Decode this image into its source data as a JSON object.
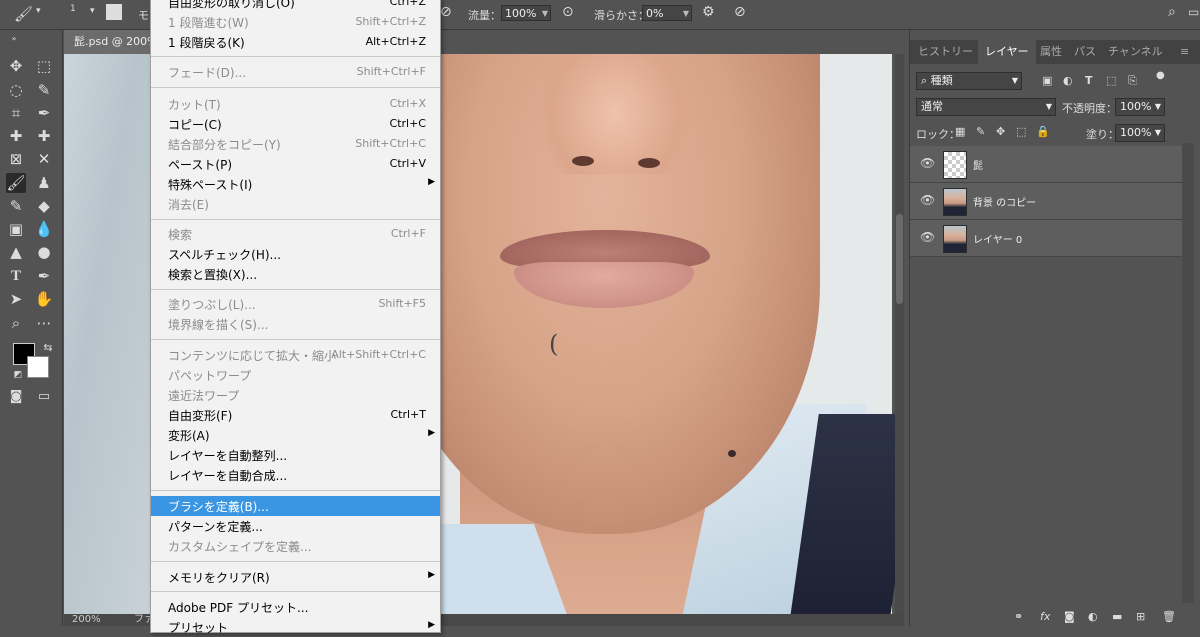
{
  "options_bar": {
    "brush_size": "1",
    "mode_label": "モ",
    "flow_label": "流量：",
    "flow_value": "100%",
    "smoothing_label": "滑らかさ：",
    "smoothing_value": "0%"
  },
  "document": {
    "tab_title": "髭.psd @ 200%",
    "zoom": "200%",
    "status": "ファ"
  },
  "edit_menu": {
    "items": [
      {
        "label": "自由変形の取り消し(O)",
        "shortcut": "Ctrl+Z",
        "disabled": false,
        "submenu": false
      },
      {
        "label": "1 段階進む(W)",
        "shortcut": "Shift+Ctrl+Z",
        "disabled": true,
        "submenu": false
      },
      {
        "label": "1 段階戻る(K)",
        "shortcut": "Alt+Ctrl+Z",
        "disabled": false,
        "submenu": false
      },
      {
        "label": "フェード(D)...",
        "shortcut": "Shift+Ctrl+F",
        "disabled": true,
        "submenu": false
      },
      {
        "label": "カット(T)",
        "shortcut": "Ctrl+X",
        "disabled": true,
        "submenu": false
      },
      {
        "label": "コピー(C)",
        "shortcut": "Ctrl+C",
        "disabled": false,
        "submenu": false
      },
      {
        "label": "結合部分をコピー(Y)",
        "shortcut": "Shift+Ctrl+C",
        "disabled": true,
        "submenu": false
      },
      {
        "label": "ペースト(P)",
        "shortcut": "Ctrl+V",
        "disabled": false,
        "submenu": false
      },
      {
        "label": "特殊ペースト(I)",
        "shortcut": "",
        "disabled": false,
        "submenu": true
      },
      {
        "label": "消去(E)",
        "shortcut": "",
        "disabled": true,
        "submenu": false
      },
      {
        "label": "検索",
        "shortcut": "Ctrl+F",
        "disabled": true,
        "submenu": false
      },
      {
        "label": "スペルチェック(H)...",
        "shortcut": "",
        "disabled": false,
        "submenu": false
      },
      {
        "label": "検索と置換(X)...",
        "shortcut": "",
        "disabled": false,
        "submenu": false
      },
      {
        "label": "塗りつぶし(L)...",
        "shortcut": "Shift+F5",
        "disabled": true,
        "submenu": false
      },
      {
        "label": "境界線を描く(S)...",
        "shortcut": "",
        "disabled": true,
        "submenu": false
      },
      {
        "label": "コンテンツに応じて拡大・縮小",
        "shortcut": "Alt+Shift+Ctrl+C",
        "disabled": true,
        "submenu": false
      },
      {
        "label": "パペットワープ",
        "shortcut": "",
        "disabled": true,
        "submenu": false
      },
      {
        "label": "遠近法ワープ",
        "shortcut": "",
        "disabled": true,
        "submenu": false
      },
      {
        "label": "自由変形(F)",
        "shortcut": "Ctrl+T",
        "disabled": false,
        "submenu": false
      },
      {
        "label": "変形(A)",
        "shortcut": "",
        "disabled": false,
        "submenu": true
      },
      {
        "label": "レイヤーを自動整列...",
        "shortcut": "",
        "disabled": false,
        "submenu": false
      },
      {
        "label": "レイヤーを自動合成...",
        "shortcut": "",
        "disabled": false,
        "submenu": false
      },
      {
        "label": "ブラシを定義(B)...",
        "shortcut": "",
        "disabled": false,
        "submenu": false,
        "highlighted": true
      },
      {
        "label": "パターンを定義...",
        "shortcut": "",
        "disabled": false,
        "submenu": false
      },
      {
        "label": "カスタムシェイプを定義...",
        "shortcut": "",
        "disabled": true,
        "submenu": false
      },
      {
        "label": "メモリをクリア(R)",
        "shortcut": "",
        "disabled": false,
        "submenu": true
      },
      {
        "label": "Adobe PDF プリセット...",
        "shortcut": "",
        "disabled": false,
        "submenu": false
      },
      {
        "label": "プリセット",
        "shortcut": "",
        "disabled": false,
        "submenu": true
      }
    ]
  },
  "layers_panel": {
    "tabs": [
      "ヒストリー",
      "レイヤー",
      "属性",
      "パス",
      "チャンネル"
    ],
    "active_tab": "レイヤー",
    "filter_kind": "種類",
    "blend_mode": "通常",
    "opacity_label": "不透明度：",
    "opacity_value": "100%",
    "lock_label": "ロック：",
    "fill_label": "塗り：",
    "fill_value": "100%",
    "layers": [
      {
        "name": "髭",
        "visible": true,
        "thumb": "transparent"
      },
      {
        "name": "背景 のコピー",
        "visible": true,
        "thumb": "photo"
      },
      {
        "name": "レイヤー 0",
        "visible": true,
        "thumb": "photo"
      }
    ]
  }
}
